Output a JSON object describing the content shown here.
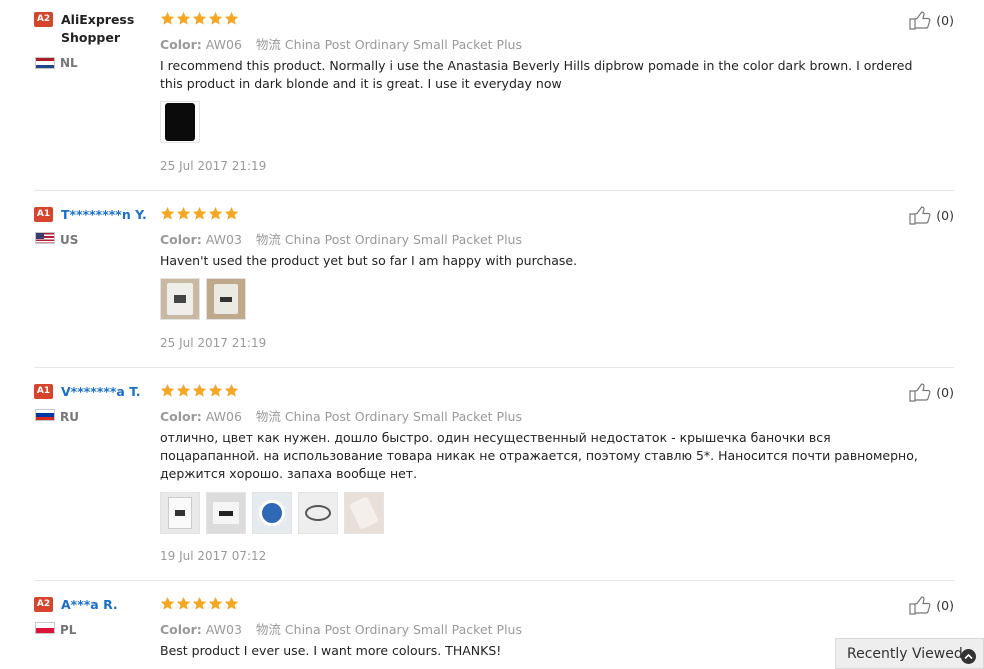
{
  "labels": {
    "color_prefix": "Color:",
    "logistics_prefix": "物流"
  },
  "reviews": [
    {
      "badge": "A2",
      "name": "AliExpress Shopper",
      "country": "NL",
      "rating": 5,
      "color_value": "AW06",
      "logistics_value": "China Post Ordinary Small Packet Plus",
      "text": "I recommend this product. Normally i use the Anastasia Beverly Hills dipbrow pomade in the color dark brown. I ordered this product in dark blonde and it is great. I use it everyday now",
      "thumbnail_count": 1,
      "date": "25 Jul 2017 21:19",
      "helpful_count": "(0)"
    },
    {
      "badge": "A1",
      "name": "T********n Y.",
      "country": "US",
      "rating": 5,
      "color_value": "AW03",
      "logistics_value": "China Post Ordinary Small Packet Plus",
      "text": "Haven't used the product yet but so far I am happy with purchase.",
      "thumbnail_count": 2,
      "date": "25 Jul 2017 21:19",
      "helpful_count": "(0)"
    },
    {
      "badge": "A1",
      "name": "V*******a T.",
      "country": "RU",
      "rating": 5,
      "color_value": "AW06",
      "logistics_value": "China Post Ordinary Small Packet Plus",
      "text": "отлично, цвет как нужен. дошло быстро. один несущественный недостаток - крышечка баночки вся поцарапанной. на использование товара никак не отражается, поэтому ставлю 5*. Наносится почти равномерно, держится хорошо. запаха вообще нет.",
      "thumbnail_count": 5,
      "date": "19 Jul 2017 07:12",
      "helpful_count": "(0)"
    },
    {
      "badge": "A2",
      "name": "A***a R.",
      "country": "PL",
      "rating": 5,
      "color_value": "AW03",
      "logistics_value": "China Post Ordinary Small Packet Plus",
      "text": "Best product I ever use. I want more colours. THANKS!",
      "thumbnail_count": 0,
      "date": "",
      "helpful_count": "(0)"
    }
  ],
  "recently_viewed": "Recently Viewed",
  "colors": {
    "badge": "#d6442d",
    "star": "#f5a623",
    "link": "#1a6fc7"
  },
  "icons": {
    "star": "star-icon",
    "thumbs_up": "thumbs-up-icon",
    "recently_viewed": "chevron-up-icon"
  }
}
